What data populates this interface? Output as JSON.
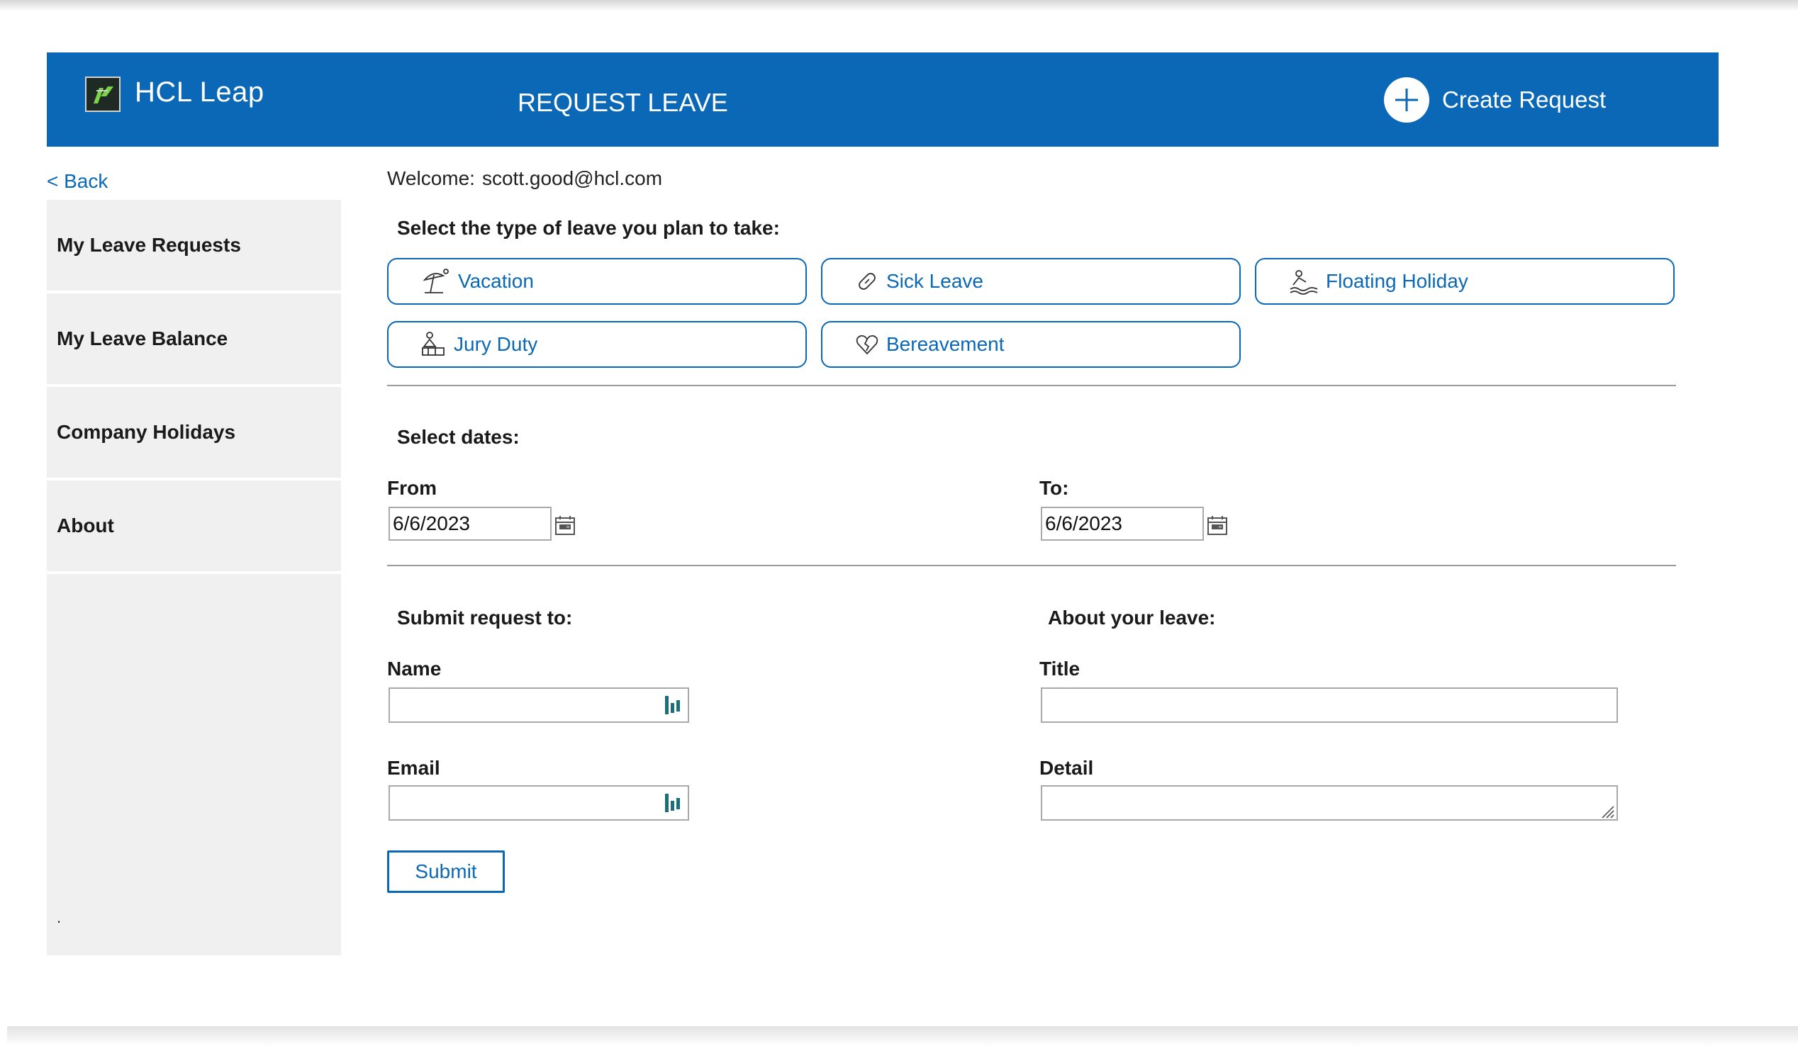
{
  "header": {
    "logo_text": "HCL Leap",
    "title": "REQUEST LEAVE",
    "create_request_label": "Create Request"
  },
  "nav": {
    "back_label": "< Back"
  },
  "sidebar": {
    "items": [
      {
        "label": "My Leave Requests"
      },
      {
        "label": "My Leave Balance"
      },
      {
        "label": "Company Holidays"
      },
      {
        "label": "About"
      }
    ],
    "footer_mark": "."
  },
  "main": {
    "welcome_label": "Welcome:",
    "welcome_email": "scott.good@hcl.com",
    "leave_type_prompt": "Select the type of leave you plan to take:",
    "leave_types": [
      {
        "label": "Vacation",
        "icon": "beach-umbrella-icon"
      },
      {
        "label": "Sick Leave",
        "icon": "bandage-icon"
      },
      {
        "label": "Floating Holiday",
        "icon": "swimmer-icon"
      },
      {
        "label": "Jury Duty",
        "icon": "courthouse-icon"
      },
      {
        "label": "Bereavement",
        "icon": "broken-heart-icon"
      }
    ],
    "dates_prompt": "Select dates:",
    "from_label": "From",
    "from_value": "6/6/2023",
    "to_label": "To:",
    "to_value": "6/6/2023",
    "submit_to_heading": "Submit request to:",
    "name_label": "Name",
    "name_value": "",
    "email_label": "Email",
    "email_value": "",
    "about_heading": "About your leave:",
    "title_label": "Title",
    "title_value": "",
    "detail_label": "Detail",
    "detail_value": "",
    "submit_label": "Submit"
  },
  "colors": {
    "brand_blue": "#0b68b6",
    "sidebar_bg": "#f0f0f0",
    "divider": "#9b9b9b",
    "picker_teal": "#1c6e7a"
  }
}
